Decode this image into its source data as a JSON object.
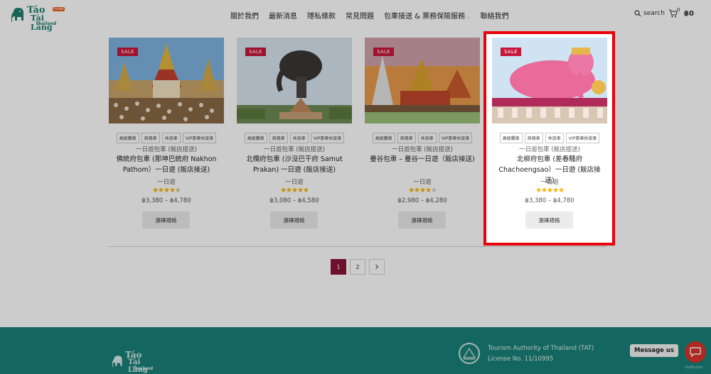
{
  "brand": {
    "line1": "Táo",
    "line2": "Tài Lắng",
    "line3": "Thailand",
    "badge": "travel"
  },
  "nav": {
    "items": [
      "關於我們",
      "最新消息",
      "隱私條款",
      "常見問題",
      "包車接送 & 票務保險服務",
      "聯絡我們"
    ]
  },
  "header": {
    "search_label": "search",
    "cart_count": "0",
    "cart_amount": "฿0"
  },
  "products": [
    {
      "sale": "SALE",
      "tags": [
        "高級轎車",
        "商務車",
        "休旅車",
        "VIP豪華休旅車"
      ],
      "category": "一日遊包車 (飯店接送)",
      "title": "佛統府包車 (那坤巴統府 Nakhon Pathom）一日遊 (飯店接送)",
      "subtitle": "一日遊",
      "rating": 4.5,
      "price": "฿3,380 – ฿4,780",
      "button": "選擇規格"
    },
    {
      "sale": "SALE",
      "tags": [
        "高級轎車",
        "商務車",
        "休旅車",
        "VIP豪華休旅車"
      ],
      "category": "一日遊包車 (飯店接送)",
      "title": "北欖府包車 (沙沒巴干府 Samut Prakan) 一日遊 (飯店接送)",
      "subtitle": "一日遊",
      "rating": 5,
      "price": "฿3,080 – ฿4,580",
      "button": "選擇規格"
    },
    {
      "sale": "SALE",
      "tags": [
        "高級轎車",
        "商務車",
        "休旅車",
        "VIP豪華休旅車"
      ],
      "category": "一日遊包車 (飯店接送)",
      "title": "曼谷包車 – 曼谷一日遊（飯店接送)",
      "subtitle": "一日遊",
      "rating": 4,
      "price": "฿2,980 – ฿4,280",
      "button": "選擇規格"
    },
    {
      "sale": "SALE",
      "tags": [
        "高級轎車",
        "商務車",
        "休旅車",
        "VIP豪華休旅車"
      ],
      "category": "一日遊包車 (飯店接送)",
      "title": "北柳府包車 (差春騷府 Chachoengsao）一日遊 (飯店接送)",
      "subtitle": "一日遊",
      "rating": 5,
      "price": "฿3,380 – ฿4,780",
      "button": "選擇規格"
    }
  ],
  "pagination": {
    "pages": [
      "1",
      "2"
    ],
    "next": "›",
    "active": "1"
  },
  "footer": {
    "brand1": "Táo",
    "brand2": "Tài Lắng",
    "brand3": "Thailand",
    "tat_line1": "Tourism Authority of Thailand (TAT)",
    "tat_line2": "License No. 11/10995",
    "message_us": "Message us",
    "getbutton": "GetButton"
  },
  "colors": {
    "teal": "#1a8079",
    "sale": "#c7163a",
    "highlight": "#e8000b",
    "star": "#f5b301",
    "page_active": "#8a1538"
  }
}
